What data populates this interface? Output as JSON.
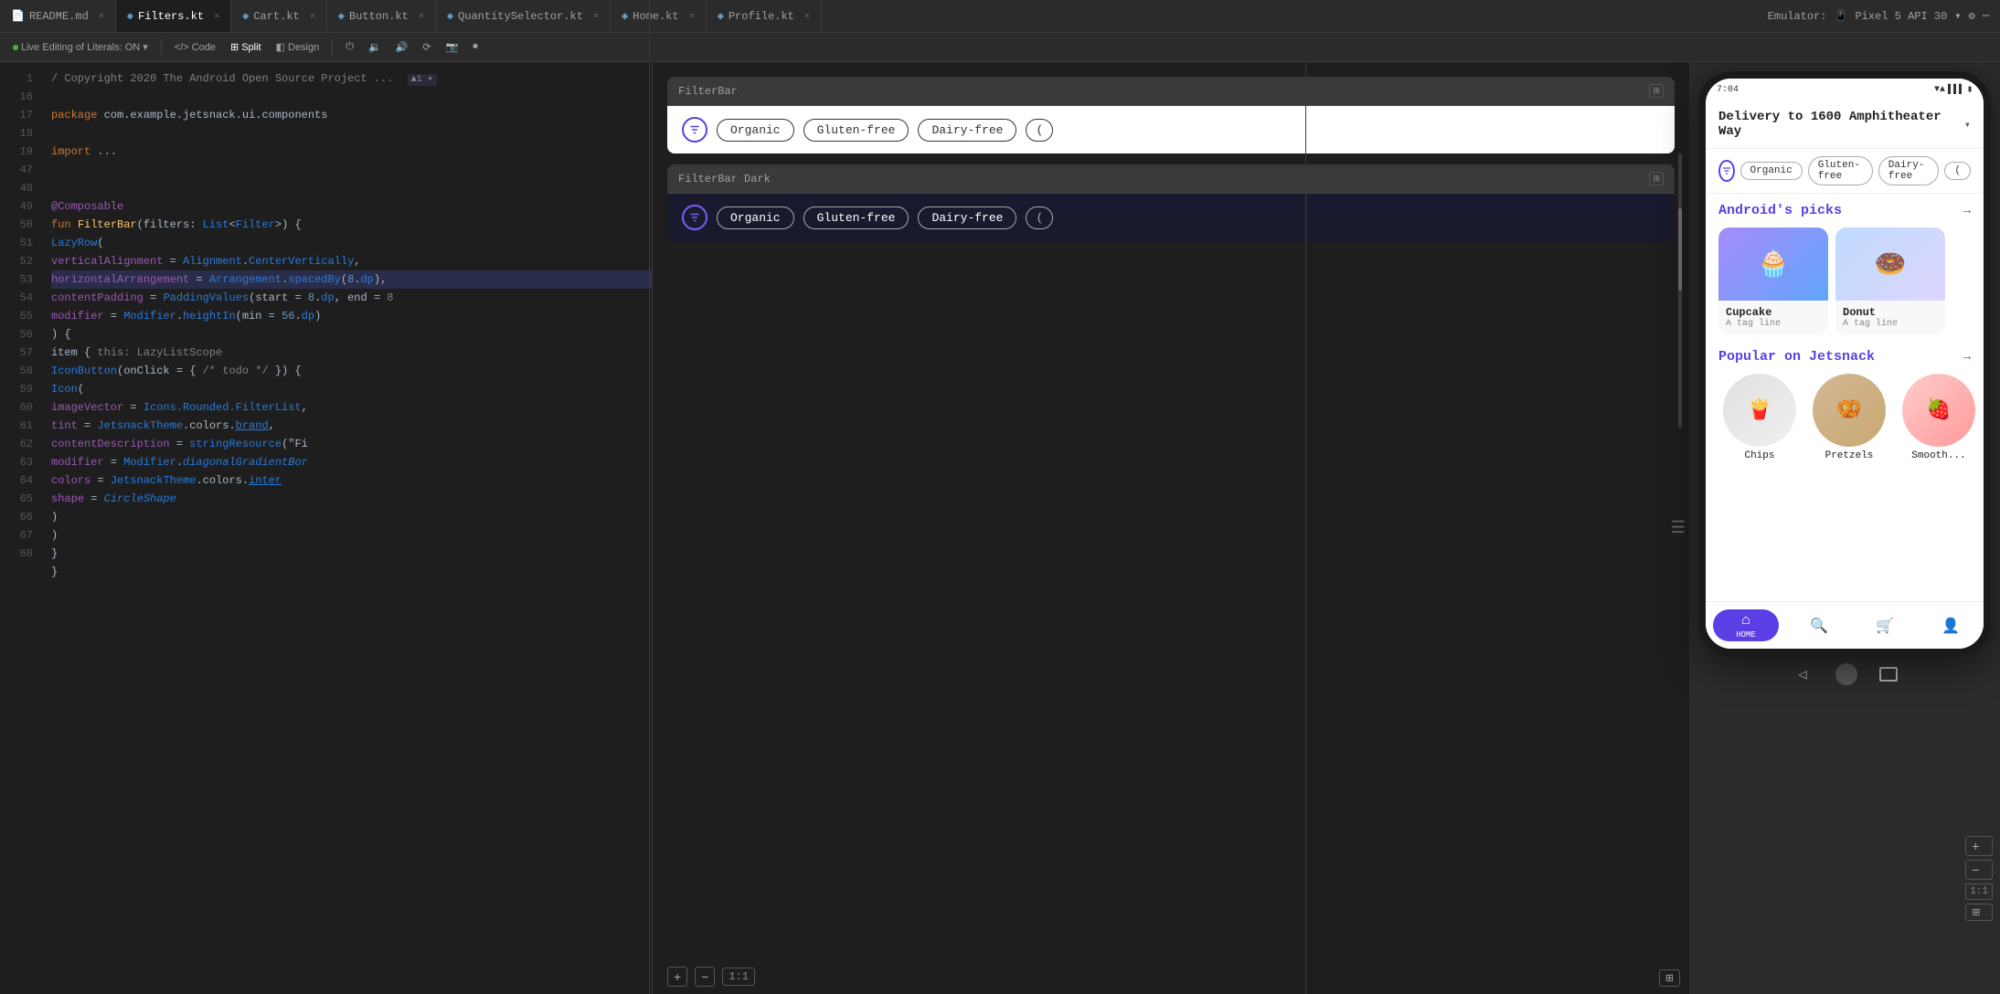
{
  "tabs": [
    {
      "label": "README.md",
      "active": false,
      "icon": "📄"
    },
    {
      "label": "Filters.kt",
      "active": true,
      "icon": "🔷"
    },
    {
      "label": "Cart.kt",
      "active": false,
      "icon": "🔷"
    },
    {
      "label": "Button.kt",
      "active": false,
      "icon": "🔷"
    },
    {
      "label": "QuantitySelector.kt",
      "active": false,
      "icon": "🔷"
    },
    {
      "label": "Home.kt",
      "active": false,
      "icon": "🔷"
    },
    {
      "label": "Profile.kt",
      "active": false,
      "icon": "🔷"
    }
  ],
  "toolbar": {
    "live_editing_label": "Live Editing of Literals: ON",
    "code_label": "Code",
    "split_label": "Split",
    "design_label": "Design"
  },
  "emulator": {
    "label": "Emulator:",
    "device": "Pixel 5 API 30"
  },
  "code": {
    "lines": [
      {
        "num": 1,
        "content": "/ Copyright 2020 The Android Open Source Project ...",
        "type": "comment"
      },
      {
        "num": 16,
        "content": "",
        "type": "empty"
      },
      {
        "num": 17,
        "content": "package com.example.jetsnack.ui.components",
        "type": "package"
      },
      {
        "num": 18,
        "content": "",
        "type": "empty"
      },
      {
        "num": 19,
        "content": "import ...",
        "type": "import"
      },
      {
        "num": 47,
        "content": "",
        "type": "empty"
      },
      {
        "num": 48,
        "content": "@Composable",
        "type": "annotation"
      },
      {
        "num": 49,
        "content": "fun FilterBar(filters: List<Filter>) {",
        "type": "code"
      },
      {
        "num": 50,
        "content": "    LazyRow(",
        "type": "code"
      },
      {
        "num": 51,
        "content": "        verticalAlignment = Alignment.CenterVertically,",
        "type": "code"
      },
      {
        "num": 52,
        "content": "        horizontalArrangement = Arrangement.spacedBy(8.dp),",
        "type": "code-highlight"
      },
      {
        "num": 53,
        "content": "        contentPadding = PaddingValues(start = 8.dp, end = 8",
        "type": "code"
      },
      {
        "num": 54,
        "content": "        modifier = Modifier.heightIn(min = 56.dp)",
        "type": "code"
      },
      {
        "num": 55,
        "content": "    ) {",
        "type": "code"
      },
      {
        "num": 56,
        "content": "        item {  this: LazyListScope",
        "type": "code"
      },
      {
        "num": 57,
        "content": "            IconButton(onClick = { /* todo */ }) {",
        "type": "code"
      },
      {
        "num": 58,
        "content": "                Icon(",
        "type": "code"
      },
      {
        "num": 59,
        "content": "                    imageVector = Icons.Rounded.FilterList,",
        "type": "code"
      },
      {
        "num": 60,
        "content": "                    tint = JetsnackTheme.colors.brand,",
        "type": "code"
      },
      {
        "num": 61,
        "content": "                    contentDescription = stringResource(\"Fi",
        "type": "code"
      },
      {
        "num": 62,
        "content": "                    modifier = Modifier.diagonalGradientBor",
        "type": "code"
      },
      {
        "num": 63,
        "content": "                        colors = JetsnackTheme.colors.inter",
        "type": "code"
      },
      {
        "num": 64,
        "content": "                        shape = CircleShape",
        "type": "code"
      },
      {
        "num": 65,
        "content": "                    )",
        "type": "code"
      },
      {
        "num": 66,
        "content": "                )",
        "type": "code"
      },
      {
        "num": 67,
        "content": "            }",
        "type": "code"
      },
      {
        "num": 68,
        "content": "        }",
        "type": "code"
      }
    ]
  },
  "filterbar_light": {
    "title": "FilterBar",
    "chips": [
      "Organic",
      "Gluten-free",
      "Dairy-free"
    ]
  },
  "filterbar_dark": {
    "title": "FilterBar Dark",
    "chips": [
      "Organic",
      "Gluten-free",
      "Dairy-free"
    ]
  },
  "phone": {
    "status_time": "7:04",
    "delivery_text": "Delivery to 1600 Amphitheater Way",
    "filter_chips": [
      "Organic",
      "Gluten-free",
      "Dairy-free"
    ],
    "androids_picks_title": "Android's picks",
    "picks": [
      {
        "name": "Cupcake",
        "tagline": "A tag line",
        "emoji": "🧁"
      },
      {
        "name": "Donut",
        "tagline": "A tag line",
        "emoji": "🍩"
      }
    ],
    "popular_title": "Popular on Jetsnack",
    "popular_items": [
      {
        "name": "Chips",
        "emoji": "🍟"
      },
      {
        "name": "Pretzels",
        "emoji": "🥨"
      },
      {
        "name": "Smooth...",
        "emoji": "🍓"
      }
    ],
    "nav_items": [
      "HOME",
      "🔍",
      "🛒",
      "👤"
    ]
  }
}
